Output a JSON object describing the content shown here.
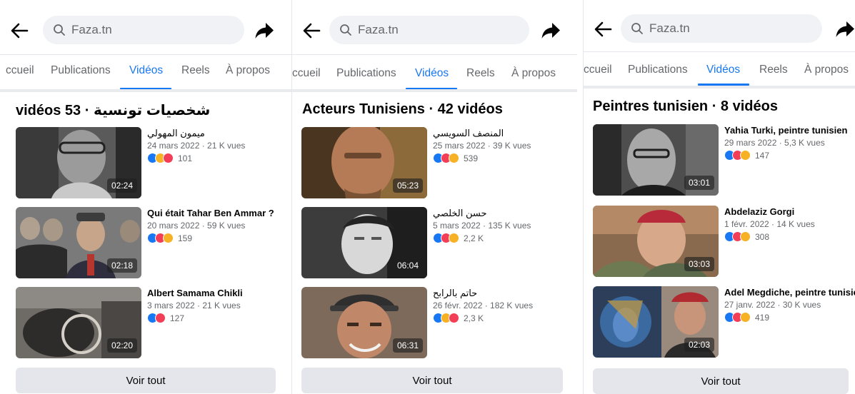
{
  "colors": {
    "accent": "#1877f2",
    "like": "#1877f2",
    "love": "#f33e58",
    "sad": "#f7b125"
  },
  "panels": [
    {
      "search": {
        "value": "Faza.tn"
      },
      "tabs": [
        {
          "label": "ccueil",
          "active": false
        },
        {
          "label": "Publications",
          "active": false
        },
        {
          "label": "Vidéos",
          "active": true
        },
        {
          "label": "Reels",
          "active": false
        },
        {
          "label": "À propos",
          "active": false
        }
      ],
      "heading": "شخصيات تونسية · 53 vidéos",
      "videos": [
        {
          "title": "ميمون المهولي",
          "meta": "24 mars 2022 · 21 K vues",
          "reactions": [
            "like-icon",
            "sad-icon",
            "love-icon"
          ],
          "count": "101",
          "duration": "02:24"
        },
        {
          "title": "Qui était Tahar Ben Ammar ?",
          "meta": "20 mars 2022 · 59 K vues",
          "reactions": [
            "like-icon",
            "love-icon",
            "care-icon"
          ],
          "count": "159",
          "duration": "02:18"
        },
        {
          "title": "Albert Samama Chikli",
          "meta": "3 mars 2022 · 21 K vues",
          "reactions": [
            "like-icon",
            "love-icon"
          ],
          "count": "127",
          "duration": "02:20"
        }
      ],
      "see_all": "Voir tout"
    },
    {
      "search": {
        "value": "Faza.tn"
      },
      "tabs": [
        {
          "label": "ccueil",
          "active": false
        },
        {
          "label": "Publications",
          "active": false
        },
        {
          "label": "Vidéos",
          "active": true
        },
        {
          "label": "Reels",
          "active": false
        },
        {
          "label": "À propos",
          "active": false
        }
      ],
      "heading": "Acteurs Tunisiens · 42 vidéos",
      "videos": [
        {
          "title": "المنصف السويسي",
          "meta": "25 mars 2022 · 39 K vues",
          "reactions": [
            "like-icon",
            "love-icon",
            "sad-icon"
          ],
          "count": "539",
          "duration": "05:23"
        },
        {
          "title": "حسن الخلصي",
          "meta": "5 mars 2022 · 135 K vues",
          "reactions": [
            "like-icon",
            "love-icon",
            "care-icon"
          ],
          "count": "2,2 K",
          "duration": "06:04"
        },
        {
          "title": "حاتم بالرابح",
          "meta": "26 févr. 2022 · 182 K vues",
          "reactions": [
            "like-icon",
            "sad-icon",
            "love-icon"
          ],
          "count": "2,3 K",
          "duration": "06:31"
        }
      ],
      "see_all": "Voir tout"
    },
    {
      "search": {
        "value": "Faza.tn"
      },
      "tabs": [
        {
          "label": "ccueil",
          "active": false
        },
        {
          "label": "Publications",
          "active": false
        },
        {
          "label": "Vidéos",
          "active": true
        },
        {
          "label": "Reels",
          "active": false
        },
        {
          "label": "À propos",
          "active": false
        }
      ],
      "heading": "Peintres tunisien · 8 vidéos",
      "videos": [
        {
          "title": "Yahia Turki, peintre tunisien",
          "meta": "29 mars 2022 · 5,3 K vues",
          "reactions": [
            "like-icon",
            "love-icon",
            "care-icon"
          ],
          "count": "147",
          "duration": "03:01"
        },
        {
          "title": "Abdelaziz Gorgi",
          "meta": "1 févr. 2022 · 14 K vues",
          "reactions": [
            "like-icon",
            "love-icon",
            "care-icon"
          ],
          "count": "308",
          "duration": "03:03"
        },
        {
          "title": "Adel Megdiche, peintre tunisien",
          "meta": "27 janv. 2022 · 30 K vues",
          "reactions": [
            "like-icon",
            "love-icon",
            "sad-icon"
          ],
          "count": "419",
          "duration": "02:03"
        }
      ],
      "see_all": "Voir tout"
    }
  ]
}
